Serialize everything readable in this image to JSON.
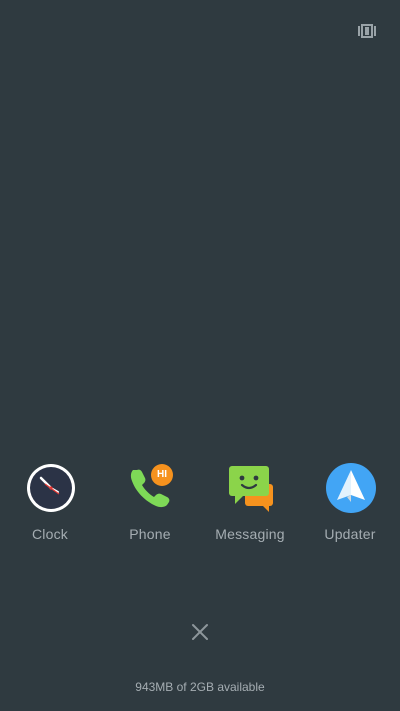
{
  "recents": {
    "apps": [
      {
        "label": "Clock",
        "icon": "clock-icon"
      },
      {
        "label": "Phone",
        "icon": "phone-icon",
        "badge": "HI"
      },
      {
        "label": "Messaging",
        "icon": "messaging-icon"
      },
      {
        "label": "Updater",
        "icon": "paper-plane-icon"
      }
    ],
    "memory_text": "943MB of 2GB available"
  },
  "colors": {
    "background": "#2f3a40",
    "label": "#a5adb2",
    "phone_green": "#7ed957",
    "badge_orange": "#f6921e",
    "messaging_green": "#8bd44a",
    "updater_blue": "#42a5f5"
  }
}
